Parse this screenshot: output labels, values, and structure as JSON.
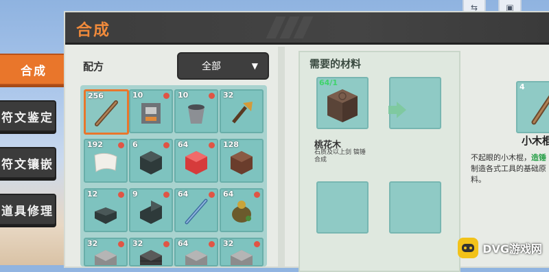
{
  "header": {
    "title": "合成"
  },
  "tabs": [
    {
      "label": "合成",
      "active": true
    },
    {
      "label": "符文鉴定",
      "active": false
    },
    {
      "label": "符文镶嵌",
      "active": false
    },
    {
      "label": "道具修理",
      "active": false
    }
  ],
  "recipe": {
    "label": "配方",
    "filter_value": "全部"
  },
  "slots": [
    {
      "count": "256",
      "item": "wooden-stick",
      "selected": true,
      "dot": false
    },
    {
      "count": "10",
      "item": "furnace",
      "selected": false,
      "dot": true
    },
    {
      "count": "10",
      "item": "bucket",
      "selected": false,
      "dot": true
    },
    {
      "count": "32",
      "item": "torch",
      "selected": false,
      "dot": false
    },
    {
      "count": "192",
      "item": "paper",
      "selected": false,
      "dot": true
    },
    {
      "count": "6",
      "item": "dark-block",
      "selected": false,
      "dot": true
    },
    {
      "count": "64",
      "item": "red-block",
      "selected": false,
      "dot": true
    },
    {
      "count": "128",
      "item": "wood-plank",
      "selected": false,
      "dot": false
    },
    {
      "count": "12",
      "item": "dark-slab",
      "selected": false,
      "dot": true
    },
    {
      "count": "9",
      "item": "dark-stairs",
      "selected": false,
      "dot": true
    },
    {
      "count": "64",
      "item": "blue-rod",
      "selected": false,
      "dot": true
    },
    {
      "count": "64",
      "item": "sack",
      "selected": false,
      "dot": true
    },
    {
      "count": "32",
      "item": "grey-block",
      "selected": false,
      "dot": true
    },
    {
      "count": "32",
      "item": "grey-brick",
      "selected": false,
      "dot": true
    },
    {
      "count": "64",
      "item": "grey-block",
      "selected": false,
      "dot": true
    },
    {
      "count": "32",
      "item": "grey-block",
      "selected": false,
      "dot": true
    }
  ],
  "materials": {
    "title": "需要的材料",
    "first": {
      "count": "64/1",
      "name": "桃花木",
      "note": "石质及以上剑 镐锤合成"
    }
  },
  "result": {
    "count": "4",
    "name": "小木棍",
    "desc_prefix": "不起眼的小木棍，",
    "desc_highlight": "造锤",
    "desc_suffix": "制造各式工具的基础原料。"
  },
  "watermark": {
    "text": "DVG游戏网"
  },
  "colors": {
    "accent": "#e9762b",
    "slot": "#7ec3bf",
    "header": "#3d3d3d"
  }
}
